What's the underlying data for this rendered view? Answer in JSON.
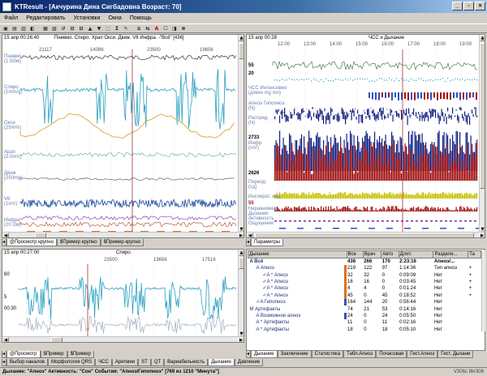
{
  "window": {
    "title": "KTResult - [Акчурина Дина Сигбадовна Возраст: 70]",
    "buttons": [
      "_",
      "▫",
      "×"
    ]
  },
  "menu": [
    "Файл",
    "Редактировать",
    "Установки",
    "Окна",
    "Помощь"
  ],
  "toolbar": [
    "▣",
    "▤",
    "▥",
    "◧",
    "▦",
    "▧",
    "↺",
    "⊡",
    "⊟",
    "▲",
    "▼",
    "⬚",
    "Σ",
    "✎",
    "≡",
    "⇆",
    "A",
    "☐",
    "◨",
    "⊗"
  ],
  "left_pane": {
    "time": "15 апр 00:26:40",
    "header": "Пневмо. Спиро. Храп Окси. Движ. V6 Инфра. -\"Всё\" [436]",
    "markers": [
      "21117",
      "14086",
      "23500",
      "19656"
    ],
    "channels": [
      {
        "name": "Пневмо",
        "unit": "(1.5Ом)"
      },
      {
        "name": "Спиро",
        "unit": "(1mm/g)"
      },
      {
        "name": "Окси",
        "unit": "(25%%)"
      },
      {
        "name": "Храп",
        "unit": "(2.0mV)"
      },
      {
        "name": "Движ",
        "unit": "(250mg)"
      },
      {
        "name": "V6",
        "unit": "(1mV)"
      },
      {
        "name": "Инфра",
        "unit": "(20 Ом)"
      }
    ],
    "tabs": [
      "@Просмотр крупно",
      "$Пример крупно",
      "$Пример крупно"
    ]
  },
  "right_pane": {
    "time": "15 апр 00:28",
    "title": "ЧСС и Дыхание",
    "hours": [
      "12:00",
      "13:00",
      "14:00",
      "15:00",
      "16:00",
      "17:00",
      "18:00",
      "19:00"
    ],
    "labels": [
      {
        "text": "55",
        "dark": true
      },
      {
        "text": "20",
        "dark": true
      },
      {
        "text": "ЧСС Интенсивно",
        "dark": false
      },
      {
        "text": "(д/мин mg mn)",
        "dark": false
      },
      {
        "text": "Апноэ Гипопноэ",
        "dark": false
      },
      {
        "text": "(N)",
        "dark": false
      },
      {
        "text": "Распред.",
        "dark": false
      },
      {
        "text": "(N)",
        "dark": false
      },
      {
        "text": "2733",
        "dark": true
      },
      {
        "text": "Инфр.",
        "dark": false
      },
      {
        "text": "(mV)",
        "dark": false
      },
      {
        "text": "2626",
        "dark": true
      },
      {
        "text": "Период",
        "dark": false
      },
      {
        "text": "(сд)",
        "dark": false
      },
      {
        "text": "Инспират. инд.",
        "dark": false
      },
      {
        "text": "55",
        "dark": true
      },
      {
        "text": "Неравномер",
        "dark": false
      },
      {
        "text": "Дыхание",
        "dark": false
      },
      {
        "text": "Активность",
        "dark": false
      },
      {
        "text": "Ощущения",
        "dark": false
      }
    ],
    "tab": "Параметры"
  },
  "bottom_left_pane": {
    "time": "15 апр 00:27:00",
    "header": "Спиро.",
    "markers": [
      "23500",
      "19656",
      "17516"
    ],
    "labels": [
      "60",
      "5",
      "00:30"
    ],
    "tabs": [
      "@Просмотр",
      "$Пример",
      "$Пример"
    ]
  },
  "events_table": {
    "columns": [
      "Дыхание",
      "Все",
      "Врач",
      "Авто",
      "Длит.",
      "Разделе...",
      "Та"
    ],
    "rows": [
      {
        "label": "A Всё",
        "all": "436",
        "doc": "266",
        "auto": "170",
        "dur": "2:23:16",
        "sect": "Апноэ/...",
        "ta": "",
        "bold": true,
        "indent": 0,
        "bar": ""
      },
      {
        "label": "A Апноэ",
        "all": "219",
        "doc": "122",
        "auto": "97",
        "dur": "1:14:36",
        "sect": "Тип апноэ",
        "ta": "+",
        "bold": false,
        "indent": 1,
        "bar": "#e07020"
      },
      {
        "label": "✓A * Апноэ",
        "all": "32",
        "doc": "32",
        "auto": "0",
        "dur": "0:09:09",
        "sect": "Нет",
        "ta": "+",
        "bold": false,
        "indent": 2,
        "bar": "#e07020"
      },
      {
        "label": "✓A * Апноэ",
        "all": "16",
        "doc": "16",
        "auto": "0",
        "dur": "0:03:45",
        "sect": "Нет",
        "ta": "+",
        "bold": false,
        "indent": 2,
        "bar": "#e07020"
      },
      {
        "label": "✓A * Апноэ",
        "all": "4",
        "doc": "4",
        "auto": "0",
        "dur": "0:01:24",
        "sect": "Нет",
        "ta": "+",
        "bold": false,
        "indent": 2,
        "bar": "#e07020"
      },
      {
        "label": "✓A * Апноэ",
        "all": "45",
        "doc": "0",
        "auto": "45",
        "dur": "0:18:52",
        "sect": "Нет",
        "ta": "+",
        "bold": false,
        "indent": 2,
        "bar": "#e07020"
      },
      {
        "label": "✓A Гипопноэ",
        "all": "164",
        "doc": "144",
        "auto": "20",
        "dur": "0:56:44",
        "sect": "Нет",
        "ta": "",
        "bold": false,
        "indent": 1,
        "bar": "#3050c0"
      },
      {
        "label": "M Артефакты",
        "all": "74",
        "doc": "21",
        "auto": "53",
        "dur": "0:14:16",
        "sect": "Нет",
        "ta": "",
        "bold": false,
        "indent": 0,
        "bar": ""
      },
      {
        "label": "A Возможное апноэ",
        "all": "24",
        "doc": "0",
        "auto": "24",
        "dur": "0:05:50",
        "sect": "Нет",
        "ta": "",
        "bold": false,
        "indent": 1,
        "bar": "#3050c0"
      },
      {
        "label": "A * Артефакты",
        "all": "11",
        "doc": "0",
        "auto": "11",
        "dur": "0:02:16",
        "sect": "Нет",
        "ta": "",
        "bold": false,
        "indent": 1,
        "bar": ""
      },
      {
        "label": "A * Артефакты",
        "all": "18",
        "doc": "0",
        "auto": "18",
        "dur": "0:05:10",
        "sect": "Нет",
        "ta": "",
        "bold": false,
        "indent": 1,
        "bar": ""
      }
    ]
  },
  "right_tabs": [
    "Дыхание",
    "Заключение",
    "Статистика",
    "Табл.Апноэ",
    "Почасовая",
    "Гист.Апноэ",
    "Гист. Дыхани"
  ],
  "bottom_tabs": [
    "Выбор каналов",
    "Морфология QRS",
    "ЧСС",
    "Аритмии",
    "ST",
    "QT",
    "Вариабельность",
    "Дыхание",
    "Давление"
  ],
  "status": {
    "text": "Дыхание: \"Апноэ\"  Активность: \"Сон\"  События: \"Апноэ/Гипопноэ\" [769 из 1210 \"Минута\"]",
    "version": "V306c  8kr306"
  },
  "colors": {
    "title_start": "#0a246a",
    "title_end": "#a6caf0",
    "cyan_signal": "#2a9fbf",
    "dark_red": "#a01010",
    "navy": "#102080",
    "olive": "#c8c000"
  }
}
